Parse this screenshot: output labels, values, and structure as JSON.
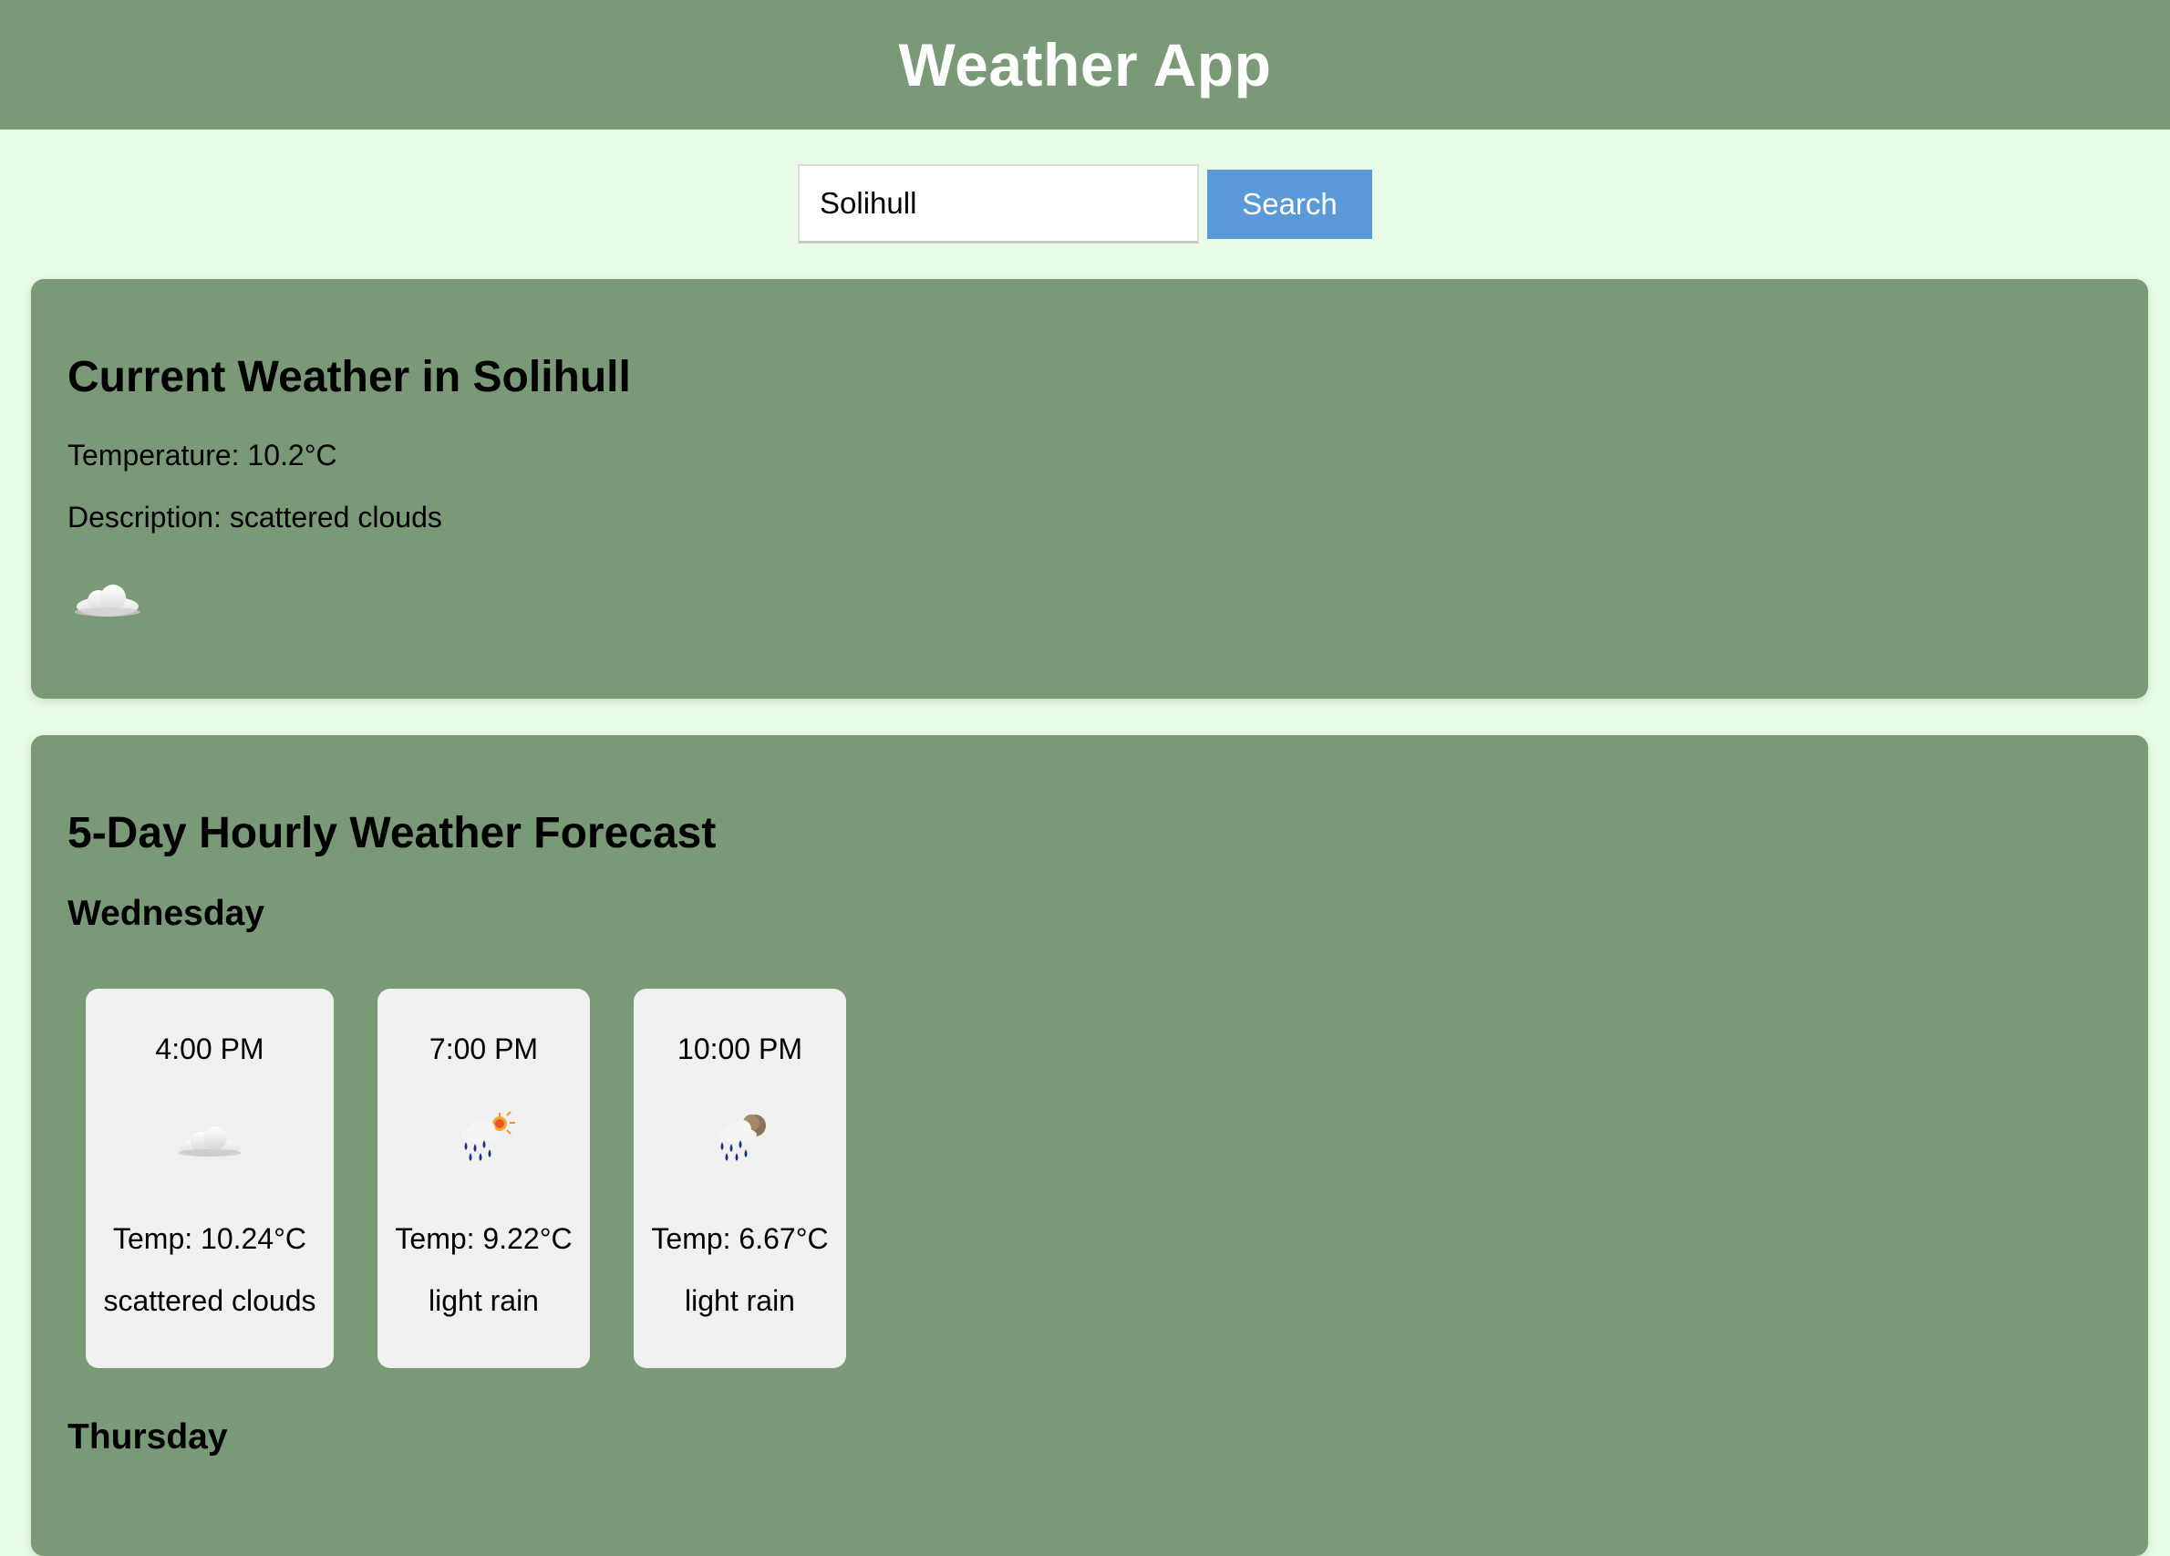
{
  "app": {
    "title": "Weather App"
  },
  "search": {
    "value": "Solihull",
    "placeholder": "",
    "button_label": "Search"
  },
  "current": {
    "heading": "Current Weather in Solihull",
    "temperature": "Temperature: 10.2°C",
    "description": "Description: scattered clouds",
    "icon": "cloud-icon"
  },
  "forecast": {
    "heading": "5-Day Hourly Weather Forecast",
    "days": [
      {
        "name": "Wednesday",
        "slots": [
          {
            "time": "4:00 PM",
            "icon": "cloud-icon",
            "temp": "Temp: 10.24°C",
            "description": "scattered clouds"
          },
          {
            "time": "7:00 PM",
            "icon": "rain-sun-icon",
            "temp": "Temp: 9.22°C",
            "description": "light rain"
          },
          {
            "time": "10:00 PM",
            "icon": "rain-moon-icon",
            "temp": "Temp: 6.67°C",
            "description": "light rain"
          }
        ]
      },
      {
        "name": "Thursday",
        "slots": []
      }
    ]
  },
  "colors": {
    "page_background": "#e8fbe6",
    "panel_green": "#7a9a77",
    "button_blue": "#5a9ad8",
    "card_background": "#f0f0f0"
  }
}
